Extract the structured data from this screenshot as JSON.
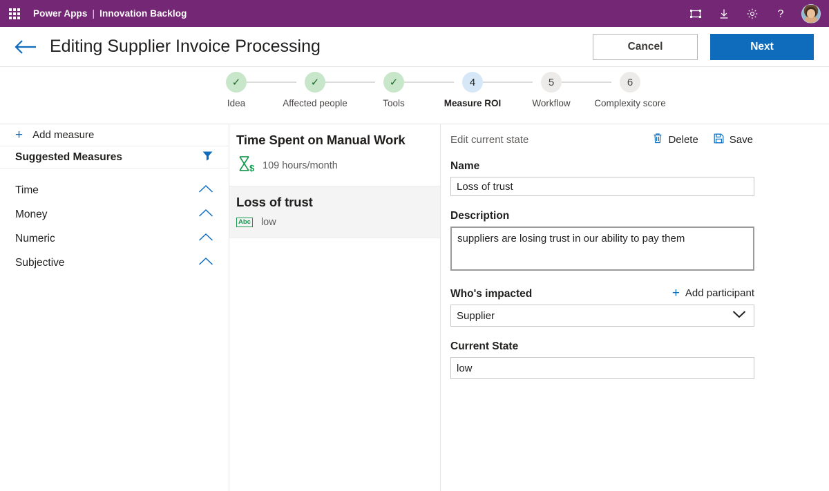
{
  "topbar": {
    "waffle_label": "app-launcher",
    "product": "Power Apps",
    "separator": "|",
    "app_name": "Innovation Backlog",
    "icons": [
      "canvas-frame-icon",
      "download-icon",
      "gear-icon",
      "help-icon",
      "avatar"
    ]
  },
  "titlebar": {
    "back_label": "back-arrow",
    "title": "Editing Supplier Invoice Processing",
    "cancel_label": "Cancel",
    "next_label": "Next"
  },
  "stepper": {
    "steps": [
      {
        "num": "1",
        "mark": "✓",
        "label": "Idea",
        "state": "done"
      },
      {
        "num": "2",
        "mark": "✓",
        "label": "Affected people",
        "state": "done"
      },
      {
        "num": "3",
        "mark": "✓",
        "label": "Tools",
        "state": "done"
      },
      {
        "num": "4",
        "mark": "4",
        "label": "Measure ROI",
        "state": "active"
      },
      {
        "num": "5",
        "mark": "5",
        "label": "Workflow",
        "state": "todo"
      },
      {
        "num": "6",
        "mark": "6",
        "label": "Complexity score",
        "state": "todo"
      }
    ]
  },
  "sidebar": {
    "add_measure_label": "Add measure",
    "suggested_title": "Suggested Measures",
    "filter_icon": "filter-icon",
    "categories": [
      {
        "label": "Time"
      },
      {
        "label": "Money"
      },
      {
        "label": "Numeric"
      },
      {
        "label": "Subjective"
      }
    ]
  },
  "measures": {
    "items": [
      {
        "title": "Time Spent on Manual Work",
        "value": "109 hours/month",
        "icon": "hourglass-dollar-icon",
        "selected": false
      },
      {
        "title": "Loss of trust",
        "value": "low",
        "icon": "abc-text-icon",
        "selected": true
      }
    ]
  },
  "details": {
    "header_label": "Edit current state",
    "delete_label": "Delete",
    "save_label": "Save",
    "name_label": "Name",
    "name_value": "Loss of trust",
    "name_placeholder": "Name",
    "description_label": "Description",
    "description_value": "suppliers are losing trust in our ability to pay them",
    "description_placeholder": "Description",
    "impacted_label": "Who's impacted",
    "add_participant_label": "Add participant",
    "impacted_value": "Supplier",
    "impacted_options": [
      "Supplier"
    ],
    "current_state_label": "Current State",
    "current_state_value": "low",
    "current_state_placeholder": "Current State"
  },
  "colors": {
    "brand_purple": "#742774",
    "accent_blue": "#0f6cbd",
    "done_green": "#c8e6c9",
    "active_blue": "#d6e8f7",
    "icon_green": "#1a9a51"
  }
}
